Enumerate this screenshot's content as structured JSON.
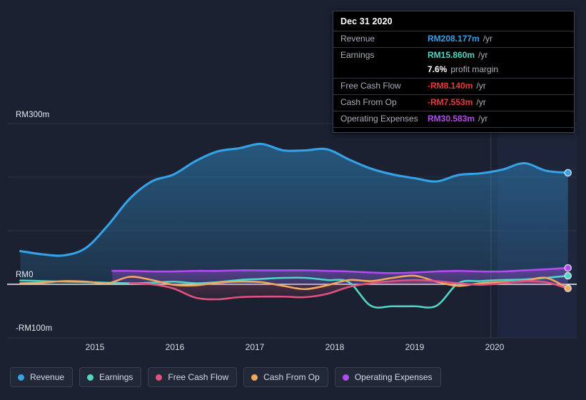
{
  "currency_prefix": "RM",
  "colors": {
    "revenue": "#35a2e8",
    "earnings": "#4fd6c4",
    "free_cash_flow": "#e0527f",
    "cash_from_op": "#f0a95c",
    "operating_expenses": "#b44bf0",
    "negative_text": "#e8393d",
    "background": "#1b2130",
    "future_background": "#1e2539",
    "gridline": "#3a4152",
    "zero_line": "#ffffff"
  },
  "tooltip": {
    "date": "Dec 31 2020",
    "rows": [
      {
        "label": "Revenue",
        "value": "RM208.177m",
        "unit": "/yr",
        "color": "#35a2e8"
      },
      {
        "label": "Earnings",
        "value": "RM15.860m",
        "unit": "/yr",
        "color": "#4fd6c4"
      },
      {
        "label": "Free Cash Flow",
        "value": "-RM8.140m",
        "unit": "/yr",
        "color": "#e8393d"
      },
      {
        "label": "Cash From Op",
        "value": "-RM7.553m",
        "unit": "/yr",
        "color": "#e8393d"
      },
      {
        "label": "Operating Expenses",
        "value": "RM30.583m",
        "unit": "/yr",
        "color": "#b44bf0"
      }
    ],
    "profit_margin_value": "7.6%",
    "profit_margin_label": "profit margin"
  },
  "legend": {
    "items": [
      {
        "label": "Revenue",
        "color": "#35a2e8"
      },
      {
        "label": "Earnings",
        "color": "#4fd6c4"
      },
      {
        "label": "Free Cash Flow",
        "color": "#e0527f"
      },
      {
        "label": "Cash From Op",
        "color": "#f0a95c"
      },
      {
        "label": "Operating Expenses",
        "color": "#b44bf0"
      }
    ]
  },
  "chart_data": {
    "type": "area",
    "title": "",
    "xlabel": "",
    "ylabel": "",
    "ylim": [
      -100,
      300
    ],
    "xlim": [
      2014.5,
      2021.0
    ],
    "grid": true,
    "legend_position": "bottom",
    "y_ticks": [
      {
        "value": 300,
        "label": "RM300m"
      },
      {
        "value": 200,
        "label": ""
      },
      {
        "value": 100,
        "label": ""
      },
      {
        "value": 0,
        "label": "RM0"
      },
      {
        "value": -100,
        "label": "-RM100m"
      }
    ],
    "x_ticks": [
      {
        "value": 2015,
        "label": "2015"
      },
      {
        "value": 2016,
        "label": "2016"
      },
      {
        "value": 2017,
        "label": "2017"
      },
      {
        "value": 2018,
        "label": "2018"
      },
      {
        "value": 2019,
        "label": "2019"
      },
      {
        "value": 2020,
        "label": "2020"
      }
    ],
    "forecast_start": 2020.02,
    "series": [
      {
        "name": "Revenue",
        "color": "#35a2e8",
        "x": [
          2014.65,
          2014.9,
          2015.15,
          2015.4,
          2015.65,
          2015.9,
          2016.15,
          2016.4,
          2016.65,
          2016.9,
          2017.15,
          2017.4,
          2017.65,
          2017.9,
          2018.15,
          2018.4,
          2018.65,
          2018.9,
          2019.15,
          2019.4,
          2019.65,
          2019.9,
          2020.15,
          2020.4,
          2020.65,
          2020.9
        ],
        "values": [
          62,
          56,
          54,
          68,
          110,
          160,
          192,
          205,
          230,
          248,
          254,
          262,
          250,
          250,
          252,
          233,
          216,
          205,
          198,
          192,
          204,
          207,
          214,
          226,
          212,
          208.177
        ]
      },
      {
        "name": "Earnings",
        "color": "#4fd6c4",
        "x": [
          2014.65,
          2014.9,
          2015.15,
          2015.4,
          2015.65,
          2015.9,
          2016.15,
          2016.4,
          2016.65,
          2016.9,
          2017.15,
          2017.4,
          2017.65,
          2017.9,
          2018.15,
          2018.4,
          2018.65,
          2018.9,
          2019.15,
          2019.4,
          2019.65,
          2019.9,
          2020.15,
          2020.4,
          2020.65,
          2020.9
        ],
        "values": [
          7,
          6,
          5,
          4,
          3,
          2,
          3,
          5,
          2,
          4,
          8,
          10,
          12,
          12,
          8,
          4,
          -40,
          -41,
          -41,
          -40,
          2,
          6,
          8,
          9,
          12,
          15.86
        ]
      },
      {
        "name": "Free Cash Flow",
        "color": "#e0527f",
        "x": [
          2015.9,
          2016.15,
          2016.4,
          2016.65,
          2016.9,
          2017.15,
          2017.4,
          2017.65,
          2017.9,
          2018.15,
          2018.4,
          2018.65,
          2018.9,
          2019.15,
          2019.4,
          2019.65,
          2019.9,
          2020.15,
          2020.4,
          2020.65,
          2020.9
        ],
        "values": [
          2,
          0,
          -8,
          -25,
          -28,
          -24,
          -23,
          -23,
          -24,
          -18,
          -5,
          2,
          6,
          8,
          6,
          2,
          -1,
          2,
          6,
          4,
          -8.14
        ]
      },
      {
        "name": "Cash From Op",
        "color": "#f0a95c",
        "x": [
          2014.65,
          2014.9,
          2015.15,
          2015.4,
          2015.65,
          2015.9,
          2016.15,
          2016.4,
          2016.65,
          2016.9,
          2017.15,
          2017.4,
          2017.65,
          2017.9,
          2018.15,
          2018.4,
          2018.65,
          2018.9,
          2019.15,
          2019.4,
          2019.65,
          2019.9,
          2020.15,
          2020.4,
          2020.65,
          2020.9
        ],
        "values": [
          2,
          3,
          6,
          5,
          2,
          14,
          8,
          -1,
          -2,
          3,
          5,
          4,
          -3,
          -9,
          -2,
          8,
          6,
          12,
          16,
          5,
          -3,
          2,
          4,
          6,
          12,
          -7.553
        ]
      },
      {
        "name": "Operating Expenses",
        "color": "#b44bf0",
        "x": [
          2015.7,
          2015.9,
          2016.15,
          2016.4,
          2016.65,
          2016.9,
          2017.15,
          2017.4,
          2017.65,
          2017.9,
          2018.15,
          2018.4,
          2018.65,
          2018.9,
          2019.15,
          2019.4,
          2019.65,
          2019.9,
          2020.15,
          2020.4,
          2020.65,
          2020.9
        ],
        "values": [
          25,
          25,
          24,
          24,
          25,
          25,
          26,
          26,
          26,
          26,
          25,
          24,
          22,
          21,
          22,
          24,
          25,
          24,
          24,
          26,
          28,
          30.583
        ]
      }
    ]
  }
}
